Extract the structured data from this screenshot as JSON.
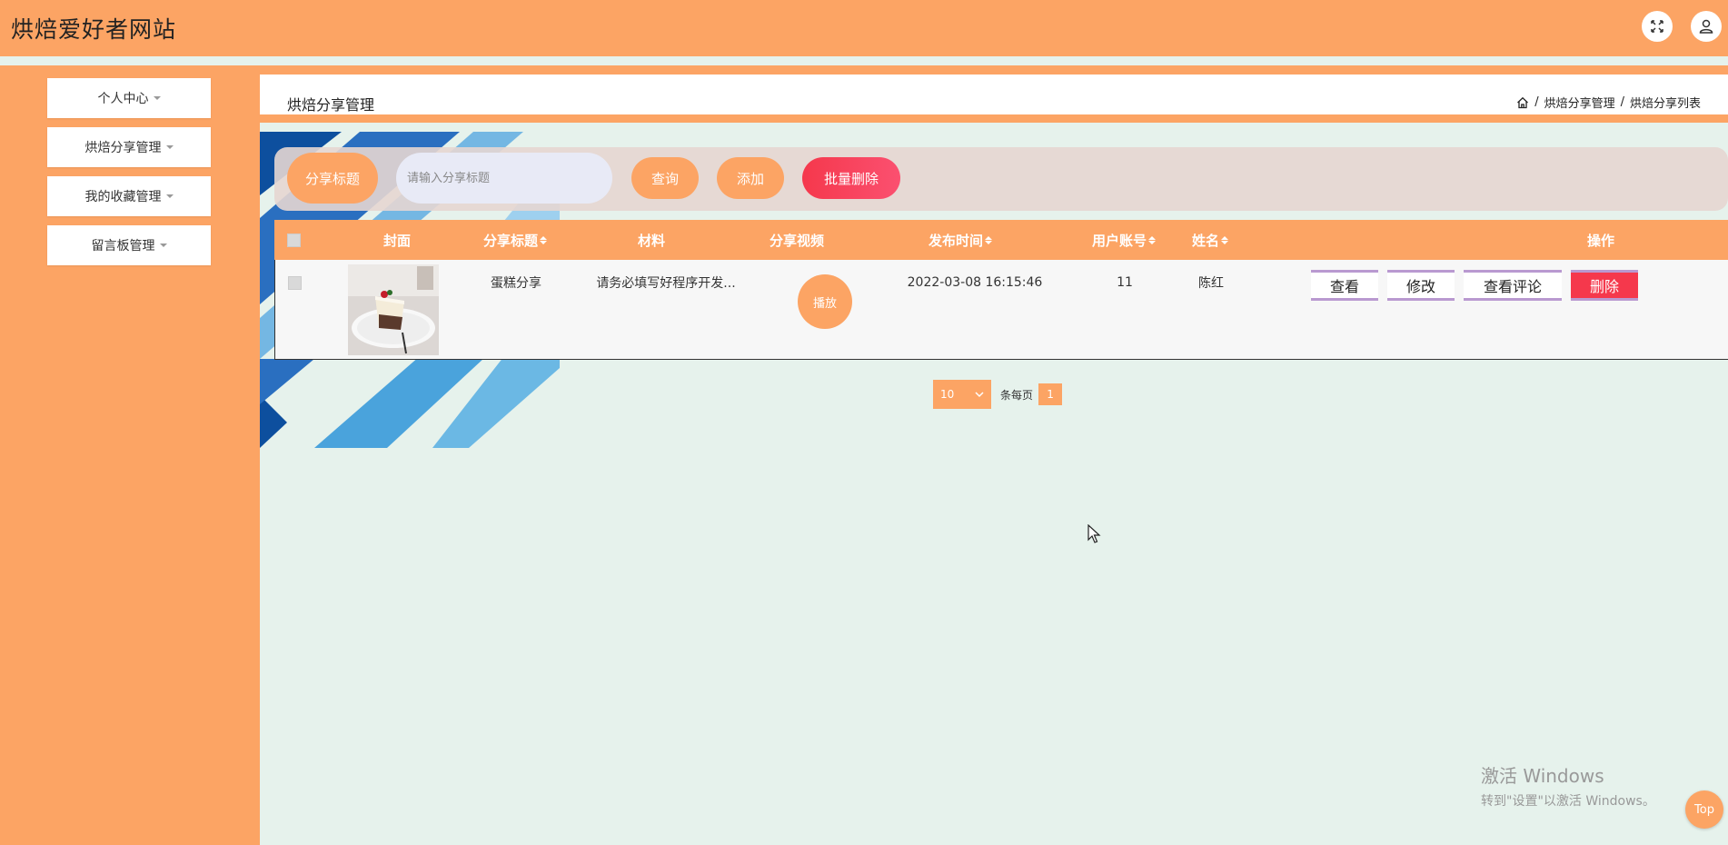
{
  "header": {
    "site_title": "烘焙爱好者网站",
    "fullscreen_icon": "expand-icon",
    "user_icon": "user-icon"
  },
  "sidebar": {
    "items": [
      {
        "label": "个人中心"
      },
      {
        "label": "烘焙分享管理"
      },
      {
        "label": "我的收藏管理"
      },
      {
        "label": "留言板管理"
      }
    ]
  },
  "page": {
    "title": "烘焙分享管理",
    "breadcrumb": [
      "烘焙分享管理",
      "烘焙分享列表"
    ],
    "breadcrumb_sep": "/"
  },
  "search": {
    "label": "分享标题",
    "placeholder": "请输入分享标题",
    "query_button": "查询",
    "add_button": "添加",
    "batch_delete_button": "批量删除"
  },
  "table": {
    "columns": [
      "封面",
      "分享标题",
      "材料",
      "分享视频",
      "发布时间",
      "用户账号",
      "姓名",
      "操作"
    ],
    "rows": [
      {
        "title": "蛋糕分享",
        "material": "请务必填写好程序开发...",
        "video_button": "播放",
        "time": "2022-03-08 16:15:46",
        "account": "11",
        "name": "陈红",
        "actions": [
          "查看",
          "修改",
          "查看评论",
          "删除"
        ]
      }
    ]
  },
  "pagination": {
    "page_size": "10",
    "per_page_label": "条每页",
    "current_page": "1"
  },
  "watermark": {
    "line1": "激活 Windows",
    "line2": "转到\"设置\"以激活 Windows。"
  },
  "back_to_top": "Top",
  "colors": {
    "primary": "#fca464",
    "danger": "#f5384c",
    "background": "#e6f2ec"
  }
}
